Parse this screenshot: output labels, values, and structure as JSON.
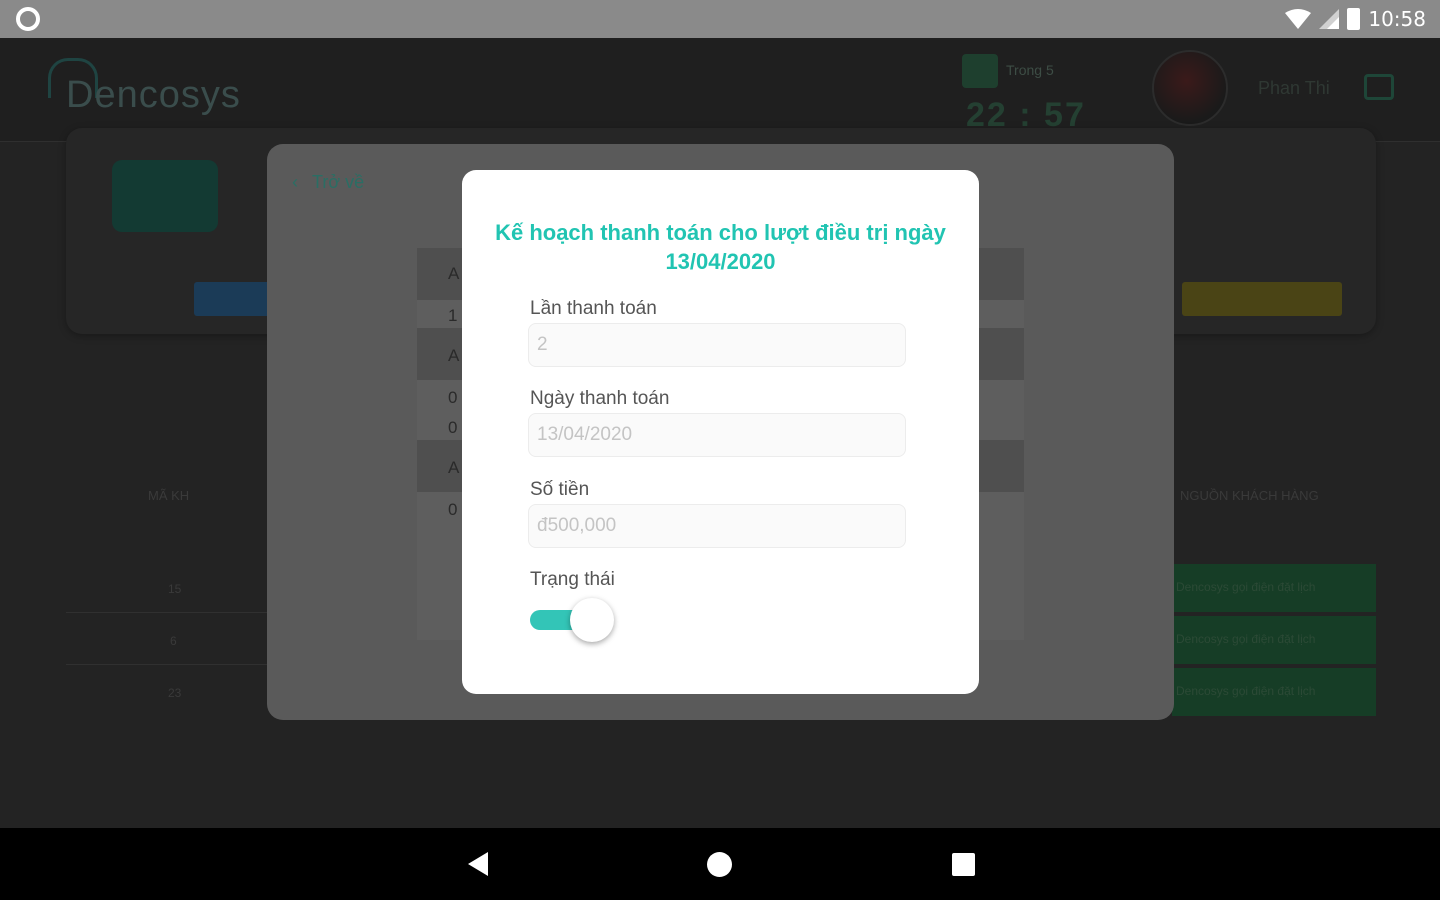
{
  "status_bar": {
    "time": "10:58",
    "icons": [
      "record-icon",
      "wifi-icon",
      "signal-icon",
      "battery-icon"
    ]
  },
  "header": {
    "logo_text": "Dencosys",
    "clock_label": "Trong 5",
    "clock_time": "22 : 57",
    "user_name": "Phan Thi"
  },
  "back_link": "Trở về",
  "dialog": {
    "title": "Kế hoạch thanh toán cho lượt điều trị ngày 13/04/2020",
    "fields": [
      {
        "label": "Lần thanh toán",
        "value": "2"
      },
      {
        "label": "Ngày thanh toán",
        "value": "13/04/2020"
      },
      {
        "label": "Số tiền",
        "value": "đ500,000"
      }
    ],
    "status_label": "Trạng thái",
    "status_on": true
  },
  "background_table": {
    "col_a": "MÃ KH",
    "col_b": "NGUỒN KHÁCH HÀNG",
    "rows": [
      {
        "id": "15",
        "source": "Dencosys gọi điện đặt lịch"
      },
      {
        "id": "6",
        "source": "Dencosys gọi điện đặt lịch"
      },
      {
        "id": "23",
        "source": "Dencosys gọi điện đặt lịch"
      }
    ]
  },
  "mid_table_cells": [
    "A",
    "1",
    "A",
    "0",
    "0",
    "A",
    "0"
  ],
  "colors": {
    "accent": "#21c4b2",
    "toggle_on": "#33c5b7"
  }
}
